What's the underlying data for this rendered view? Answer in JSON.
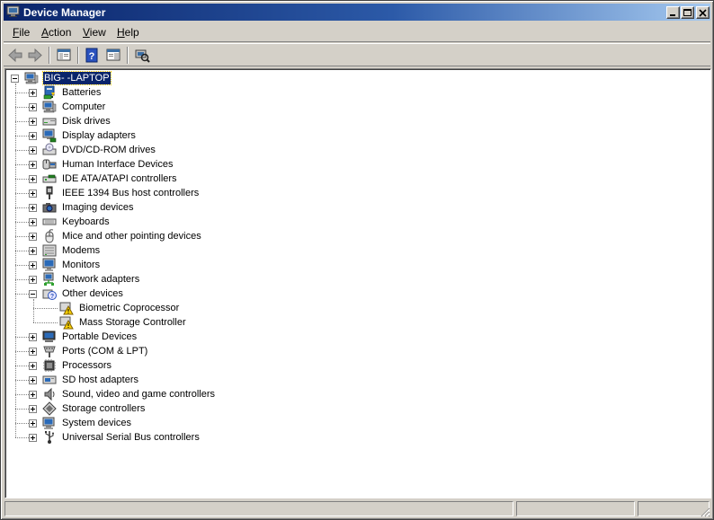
{
  "window": {
    "title": "Device Manager"
  },
  "menu": [
    {
      "label": "File",
      "key": "F",
      "rest": "ile"
    },
    {
      "label": "Action",
      "key": "A",
      "rest": "ction"
    },
    {
      "label": "View",
      "key": "V",
      "rest": "iew"
    },
    {
      "label": "Help",
      "key": "H",
      "rest": "elp"
    }
  ],
  "toolbar": {
    "buttons": [
      "back-arrow-icon",
      "forward-arrow-icon",
      "console-tree-icon",
      "help-icon",
      "properties-icon",
      "scan-hardware-icon"
    ]
  },
  "tree": {
    "root": {
      "label": "BIG-      -LAPTOP",
      "icon": "computer-icon",
      "expanded": true,
      "selected": true
    },
    "categories": [
      {
        "label": "Batteries",
        "icon": "battery-icon",
        "expanded": false
      },
      {
        "label": "Computer",
        "icon": "computer-icon",
        "expanded": false
      },
      {
        "label": "Disk drives",
        "icon": "disk-drive-icon",
        "expanded": false
      },
      {
        "label": "Display adapters",
        "icon": "display-adapter-icon",
        "expanded": false
      },
      {
        "label": "DVD/CD-ROM drives",
        "icon": "dvd-drive-icon",
        "expanded": false
      },
      {
        "label": "Human Interface Devices",
        "icon": "hid-icon",
        "expanded": false
      },
      {
        "label": "IDE ATA/ATAPI controllers",
        "icon": "ide-controller-icon",
        "expanded": false
      },
      {
        "label": "IEEE 1394 Bus host controllers",
        "icon": "ieee1394-icon",
        "expanded": false
      },
      {
        "label": "Imaging devices",
        "icon": "camera-icon",
        "expanded": false
      },
      {
        "label": "Keyboards",
        "icon": "keyboard-icon",
        "expanded": false
      },
      {
        "label": "Mice and other pointing devices",
        "icon": "mouse-icon",
        "expanded": false
      },
      {
        "label": "Modems",
        "icon": "modem-icon",
        "expanded": false
      },
      {
        "label": "Monitors",
        "icon": "monitor-icon",
        "expanded": false
      },
      {
        "label": "Network adapters",
        "icon": "network-adapter-icon",
        "expanded": false
      },
      {
        "label": "Other devices",
        "icon": "unknown-device-icon",
        "expanded": true,
        "children": [
          {
            "label": "Biometric Coprocessor",
            "icon": "warning-device-icon"
          },
          {
            "label": "Mass Storage Controller",
            "icon": "warning-device-icon"
          }
        ]
      },
      {
        "label": "Portable Devices",
        "icon": "portable-device-icon",
        "expanded": false
      },
      {
        "label": "Ports (COM & LPT)",
        "icon": "port-icon",
        "expanded": false
      },
      {
        "label": "Processors",
        "icon": "processor-icon",
        "expanded": false
      },
      {
        "label": "SD host adapters",
        "icon": "sd-adapter-icon",
        "expanded": false
      },
      {
        "label": "Sound, video and game controllers",
        "icon": "speaker-icon",
        "expanded": false
      },
      {
        "label": "Storage controllers",
        "icon": "storage-controller-icon",
        "expanded": false
      },
      {
        "label": "System devices",
        "icon": "system-device-icon",
        "expanded": false
      },
      {
        "label": "Universal Serial Bus controllers",
        "icon": "usb-icon",
        "expanded": false
      }
    ]
  },
  "colors": {
    "titlebar_start": "#0a246a",
    "titlebar_end": "#a6caf0",
    "chrome": "#d4d0c8",
    "selection": "#0a246a"
  }
}
